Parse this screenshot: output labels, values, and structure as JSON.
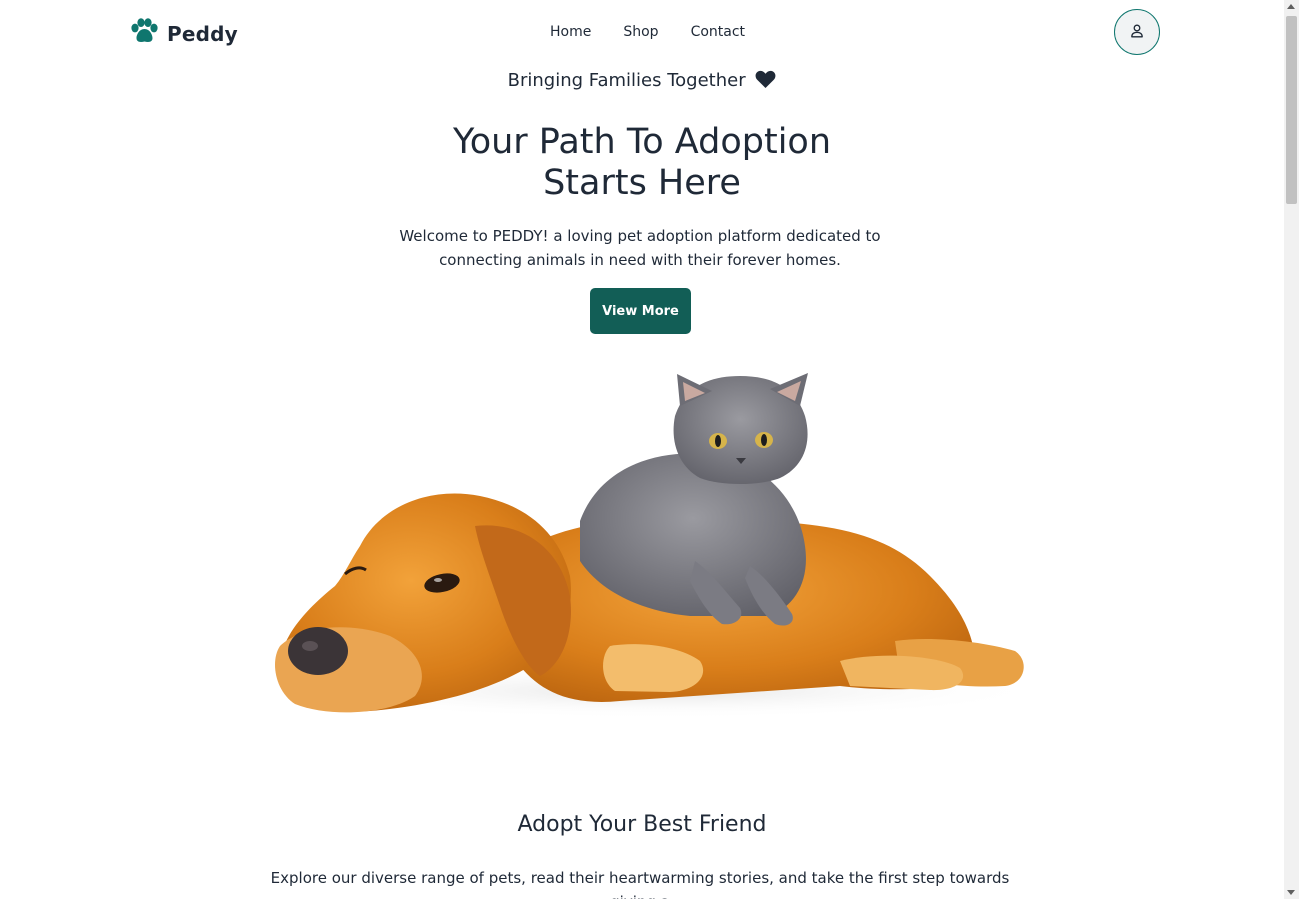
{
  "brand": {
    "name": "Peddy",
    "icon": "paw-icon",
    "color": "#0f766e"
  },
  "nav": {
    "items": [
      {
        "label": "Home"
      },
      {
        "label": "Shop"
      },
      {
        "label": "Contact"
      }
    ]
  },
  "profile": {
    "icon": "user-icon"
  },
  "hero": {
    "tagline": "Bringing Families Together",
    "tagline_icon": "heart-icon",
    "title_line1": "Your Path To Adoption",
    "title_line2": "Starts Here",
    "description": "Welcome to PEDDY! a loving pet adoption platform dedicated to connecting animals in need with their forever homes.",
    "cta_label": "View More",
    "image_alt": "golden retriever and grey kitten"
  },
  "section": {
    "title": "Adopt Your Best Friend",
    "description": "Explore our diverse range of pets, read their heartwarming stories, and take the first step towards giving a"
  },
  "colors": {
    "accent": "#125e56",
    "text": "#1f2937"
  }
}
